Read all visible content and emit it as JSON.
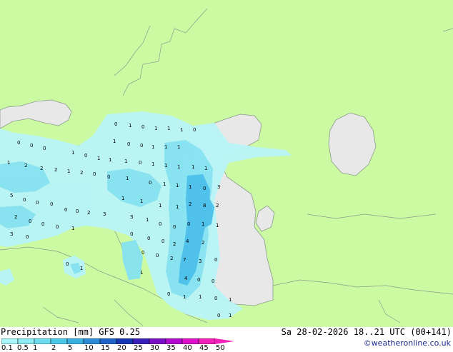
{
  "footer": {
    "left_title": "Precipitation [mm]  GFS 0.25",
    "right_title": "Sa 28-02-2026 18..21 UTC (00+141)",
    "credit": "©weatheronline.co.uk"
  },
  "legend": {
    "ticks": [
      "0.1",
      "0.5",
      "1",
      "2",
      "5",
      "10",
      "15",
      "20",
      "25",
      "30",
      "35",
      "40",
      "45",
      "50"
    ],
    "colors": [
      "#a6f5f8",
      "#8cecf4",
      "#6cdcee",
      "#4cc8e8",
      "#38b0e0",
      "#2a8ad6",
      "#1f62c8",
      "#1436b2",
      "#3a1fb8",
      "#7a10c6",
      "#b20ad0",
      "#dd10cc",
      "#f020b8"
    ]
  },
  "colors": {
    "land": "#cbfaa3",
    "water": "#e8e8e8",
    "coast": "#8a9a8a",
    "precip_light": "#b8f4f8",
    "precip_mid": "#86e2f0",
    "precip_strong": "#4cc0ea"
  },
  "map_labels": {
    "values": [
      "0",
      "1",
      "0",
      "1",
      "1",
      "1",
      "0",
      "0",
      "0",
      "0",
      "1",
      "0",
      "0",
      "1",
      "1",
      "1",
      "1",
      "0",
      "1",
      "1",
      "1",
      "0",
      "1",
      "1",
      "1",
      "1",
      "1",
      "1",
      "2",
      "2",
      "2",
      "1",
      "2",
      "0",
      "0",
      "1",
      "0",
      "1",
      "1",
      "1",
      "0",
      "3",
      "5",
      "0",
      "0",
      "0",
      "0",
      "0",
      "2",
      "3",
      "1",
      "1",
      "1",
      "1",
      "2",
      "8",
      "2",
      "2",
      "0",
      "0",
      "0",
      "1",
      "3",
      "1",
      "0",
      "0",
      "0",
      "1",
      "1",
      "3",
      "0",
      "0",
      "0",
      "0",
      "2",
      "4",
      "2",
      "0",
      "0",
      "2",
      "7",
      "3",
      "0",
      "0",
      "1",
      "1",
      "4",
      "0",
      "0",
      "0",
      "1",
      "1",
      "0",
      "1",
      "0",
      "1",
      "1",
      "0",
      "1",
      "1"
    ]
  }
}
